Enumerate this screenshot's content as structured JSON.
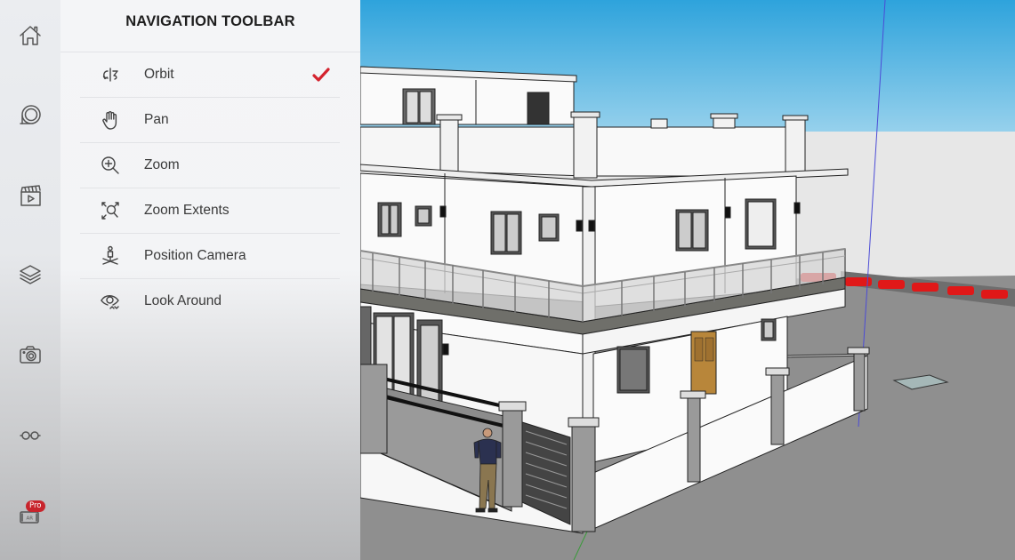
{
  "rail": {
    "items": [
      {
        "name": "home",
        "icon": "home-icon"
      },
      {
        "name": "measure",
        "icon": "tape-measure-icon"
      },
      {
        "name": "scenes",
        "icon": "clapperboard-icon"
      },
      {
        "name": "layers",
        "icon": "layers-icon"
      },
      {
        "name": "export",
        "icon": "camera-icon"
      },
      {
        "name": "display",
        "icon": "glasses-icon"
      },
      {
        "name": "ar",
        "icon": "ar-viewer-icon",
        "badge": "Pro",
        "icon_text": "AR"
      }
    ]
  },
  "panel": {
    "title": "NAVIGATION TOOLBAR",
    "items": [
      {
        "label": "Orbit",
        "icon": "orbit-icon",
        "selected": true
      },
      {
        "label": "Pan",
        "icon": "hand-icon",
        "selected": false
      },
      {
        "label": "Zoom",
        "icon": "zoom-in-icon",
        "selected": false
      },
      {
        "label": "Zoom Extents",
        "icon": "zoom-extents-icon",
        "selected": false
      },
      {
        "label": "Position Camera",
        "icon": "position-camera-icon",
        "selected": false
      },
      {
        "label": "Look Around",
        "icon": "eye-icon",
        "selected": false
      }
    ]
  },
  "colors": {
    "accent": "#d4232e",
    "sky_top": "#2ea3dc",
    "sky_bottom": "#a9d9ef",
    "ground": "#8e8e8e"
  },
  "viewport": {
    "model": "two-storey house 3D model with balcony, perimeter wall and figure"
  }
}
